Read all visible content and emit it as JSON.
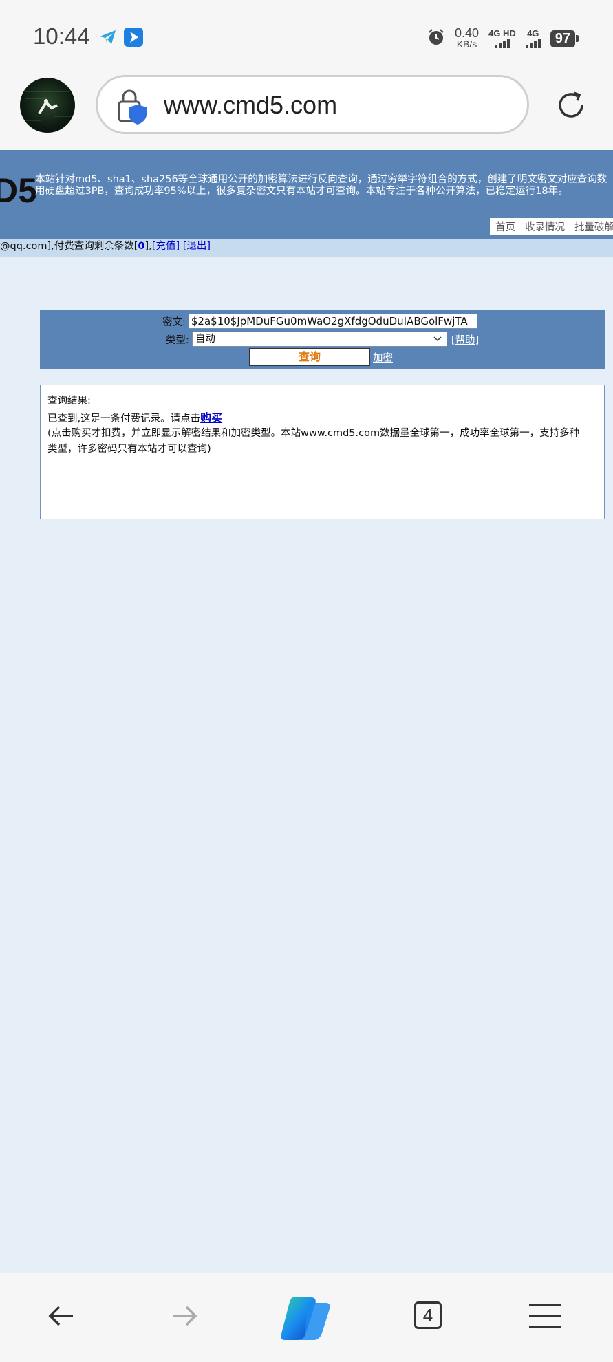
{
  "status_bar": {
    "time": "10:44",
    "net_speed_value": "0.40",
    "net_speed_unit": "KB/s",
    "sim1_label": "4G HD",
    "sim2_label": "4G",
    "battery": "97"
  },
  "browser": {
    "url": "www.cmd5.com",
    "tab_count": "4"
  },
  "site": {
    "logo": "D5",
    "intro_line1": "本站针对md5、sha1、sha256等全球通用公开的加密算法进行反向查询，通过穷举字符组合的方式，创建了明文密文对应查询数",
    "intro_line2": "用硬盘超过3PB，查询成功率95%以上，很多复杂密文只有本站才可查询。本站专注于各种公开算法，已稳定运行18年。",
    "nav": [
      "首页",
      "收录情况",
      "批量破解"
    ]
  },
  "userbar": {
    "prefix": "@qq.com],付费查询剩余条数[",
    "count": "0",
    "mid": "],",
    "recharge": "[充值]",
    "logout": "[退出]"
  },
  "form": {
    "cipher_label": "密文:",
    "cipher_value": "$2a$10$JpMDuFGu0mWaO2gXfdgOduDuIABGolFwjTA",
    "type_label": "类型:",
    "type_value": "自动",
    "help_open": "[",
    "help": "帮助",
    "help_close": "]",
    "query_button": "查询",
    "encrypt_link": "加密"
  },
  "result": {
    "heading": "查询结果:",
    "found_text": "已查到,这是一条付费记录。请点击",
    "buy_link": "购买",
    "note_line1": "(点击购买才扣费，并立即显示解密结果和加密类型。本站www.cmd5.com数据量全球第一，成功率全球第一，支持多种",
    "note_line2": "类型，许多密码只有本站才可以查询)"
  }
}
